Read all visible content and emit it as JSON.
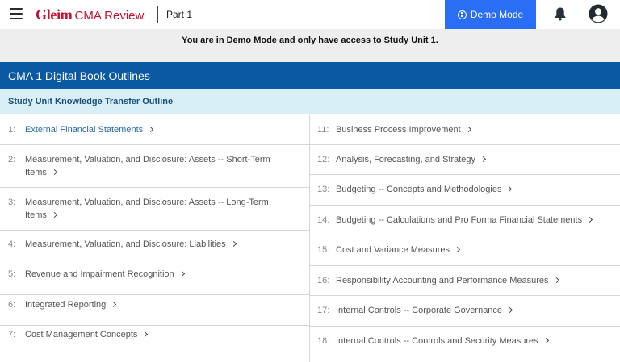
{
  "header": {
    "logo_brand": "Gleim",
    "logo_product": "CMA Review",
    "part_label": "Part 1",
    "demo_button_label": "Demo Mode"
  },
  "banner": {
    "text": "You are in Demo Mode and only have access to Study Unit 1."
  },
  "section": {
    "title": "CMA 1 Digital Book Outlines",
    "subheader": "Study Unit Knowledge Transfer Outline"
  },
  "outline": {
    "left": [
      {
        "num": "1:",
        "title": "External Financial Statements"
      },
      {
        "num": "2:",
        "title": "Measurement, Valuation, and Disclosure: Assets -- Short-Term Items"
      },
      {
        "num": "3:",
        "title": "Measurement, Valuation, and Disclosure: Assets -- Long-Term Items"
      },
      {
        "num": "4:",
        "title": "Measurement, Valuation, and Disclosure: Liabilities"
      },
      {
        "num": "5:",
        "title": "Revenue and Impairment Recognition"
      },
      {
        "num": "6:",
        "title": "Integrated Reporting"
      },
      {
        "num": "7:",
        "title": "Cost Management Concepts"
      }
    ],
    "right": [
      {
        "num": "11:",
        "title": "Business Process Improvement"
      },
      {
        "num": "12:",
        "title": "Analysis, Forecasting, and Strategy"
      },
      {
        "num": "13:",
        "title": "Budgeting -- Concepts and Methodologies"
      },
      {
        "num": "14:",
        "title": "Budgeting -- Calculations and Pro Forma Financial Statements"
      },
      {
        "num": "15:",
        "title": "Cost and Variance Measures"
      },
      {
        "num": "16:",
        "title": "Responsibility Accounting and Performance Measures"
      },
      {
        "num": "17:",
        "title": "Internal Controls -- Corporate Governance"
      },
      {
        "num": "18:",
        "title": "Internal Controls -- Controls and Security Measures"
      }
    ]
  },
  "colors": {
    "brand_red": "#c8102e",
    "demo_button_blue": "#2a6ef5",
    "section_header_blue": "#0b58a3",
    "subheader_light_blue": "#d9eff8",
    "active_link_blue": "#2a6aa8"
  },
  "icons": {
    "menu": "hamburger-menu-icon",
    "demo": "info-icon",
    "notifications": "bell-icon",
    "account": "user-account-icon",
    "item_arrow": "chevron-right-icon"
  }
}
